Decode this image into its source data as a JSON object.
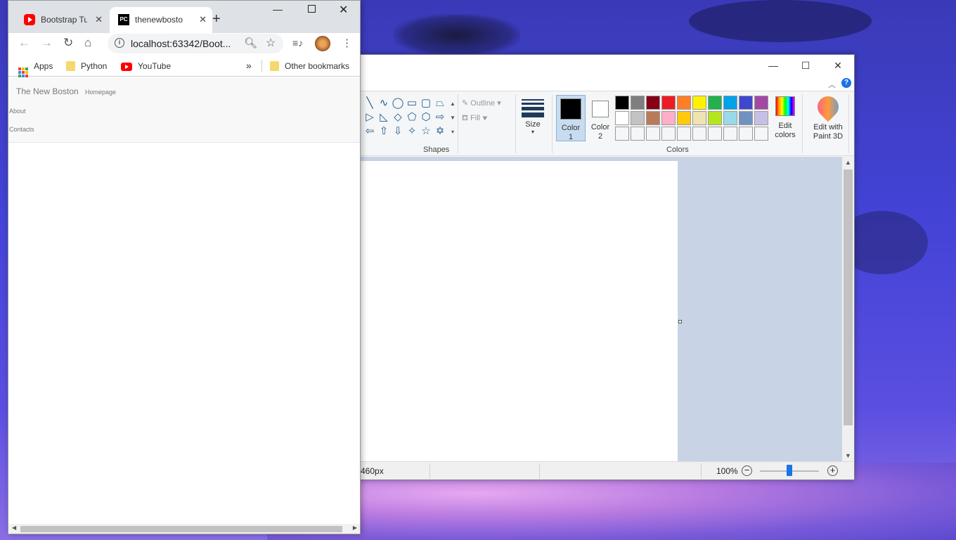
{
  "paint": {
    "window_controls": {
      "minimize": "—",
      "maximize": "☐",
      "close": "✕"
    },
    "help": "?",
    "shapes_label": "Shapes",
    "shape_glyphs": [
      "╲",
      "∿",
      "◯",
      "▭",
      "▢",
      "⏢",
      "▷",
      "◺",
      "◇",
      "⬠",
      "⬡",
      "⇨",
      "⇦",
      "⇧",
      "⇩",
      "✧",
      "☆",
      "✡"
    ],
    "outline_label": "Outline",
    "fill_label": "Fill",
    "size_label": "Size",
    "color1_label": "Color",
    "color1_num": "1",
    "color2_label": "Color",
    "color2_num": "2",
    "color1_value": "#000000",
    "color2_value": "#ffffff",
    "palette": [
      "#000000",
      "#7f7f7f",
      "#880015",
      "#ed1c24",
      "#ff7f27",
      "#fff200",
      "#22b14c",
      "#00a2e8",
      "#3f48cc",
      "#a349a4",
      "#ffffff",
      "#c3c3c3",
      "#b97a57",
      "#ffaec9",
      "#ffc90e",
      "#efe4b0",
      "#b5e61d",
      "#99d9ea",
      "#7092be",
      "#c8bfe7",
      "#f5f6f7",
      "#f5f6f7",
      "#f5f6f7",
      "#f5f6f7",
      "#f5f6f7",
      "#f5f6f7",
      "#f5f6f7",
      "#f5f6f7",
      "#f5f6f7",
      "#f5f6f7"
    ],
    "colors_label": "Colors",
    "edit_colors_line1": "Edit",
    "edit_colors_line2": "colors",
    "paint3d_line1": "Edit with",
    "paint3d_line2": "Paint 3D",
    "status_size": "460px",
    "zoom": "100%"
  },
  "chrome": {
    "tabs": [
      {
        "title": "Bootstrap Tu",
        "icon": "youtube-icon"
      },
      {
        "title": "thenewbosto",
        "icon": "pycharm-icon",
        "icon_text": "PC"
      }
    ],
    "new_tab": "+",
    "url": "localhost:63342/Boot...",
    "bookmarks": {
      "apps": "Apps",
      "python": "Python",
      "youtube": "YouTube",
      "more": "»",
      "other": "Other bookmarks"
    },
    "page": {
      "brand": "The New Boston",
      "nav": [
        "Homepage",
        "About",
        "Contacts"
      ]
    }
  }
}
